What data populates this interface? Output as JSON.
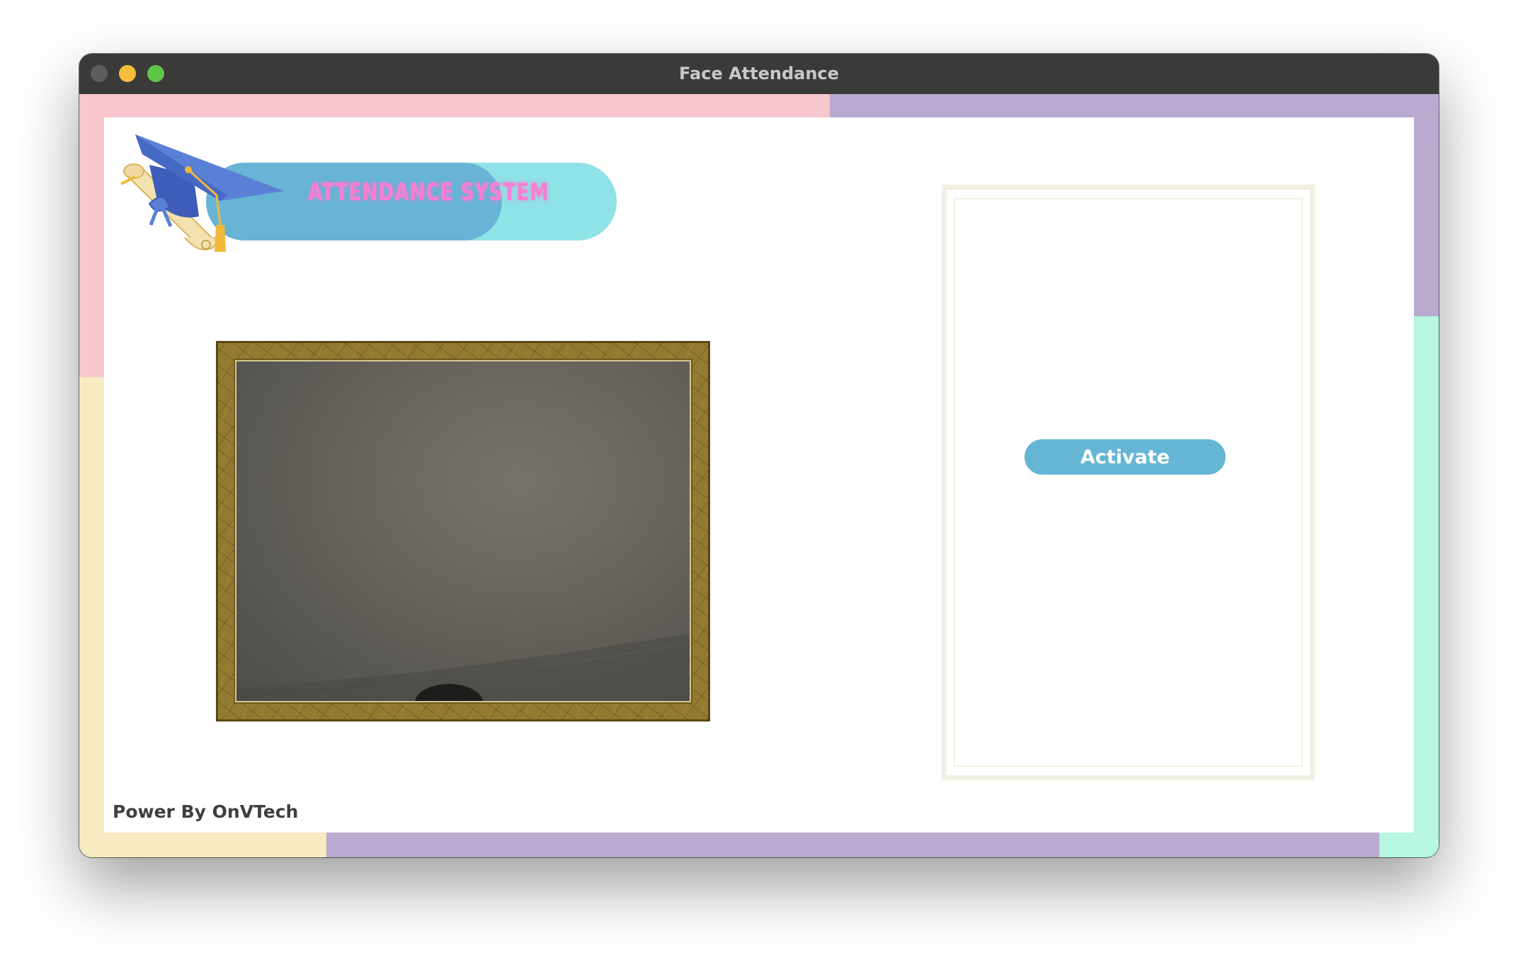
{
  "window": {
    "title": "Face Attendance",
    "controls": [
      "close",
      "minimize",
      "maximize"
    ]
  },
  "header": {
    "logo_text": "ATTENDANCE SYSTEM",
    "logo_icons": [
      "graduation-cap-icon",
      "diploma-scroll-icon"
    ]
  },
  "camera": {
    "feed_label": "webcam-feed"
  },
  "actions": {
    "activate_label": "Activate"
  },
  "footer": {
    "credit": "Power By OnVTech"
  },
  "colors": {
    "titlebar": "#3a3a38",
    "accent_button": "#65b6d4",
    "pill_light": "#8fe2e6",
    "pill_dark": "#67b4d5",
    "logo_text": "#f77fd3",
    "frame_gold": "#927b31",
    "border_pink": "#f8c6cd",
    "border_lavender": "#baaad0",
    "border_cream": "#f6ebc1",
    "border_mint": "#b6f6e3"
  }
}
